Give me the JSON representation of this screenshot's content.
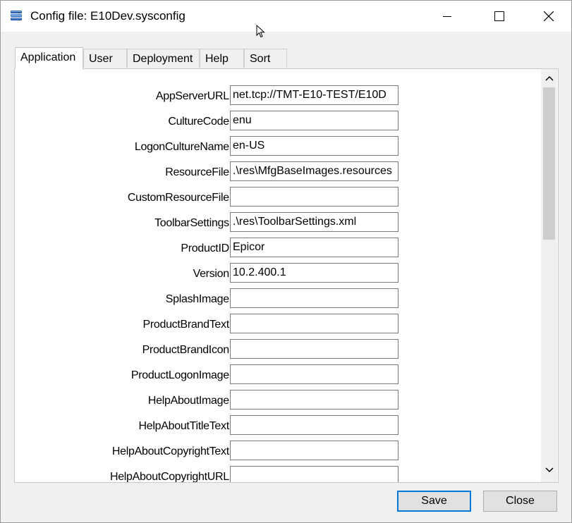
{
  "window": {
    "title": "Config file: E10Dev.sysconfig",
    "icon": "database-stack-icon"
  },
  "tabs": [
    {
      "label": "Application",
      "active": true
    },
    {
      "label": "User",
      "active": false
    },
    {
      "label": "Deployment",
      "active": false
    },
    {
      "label": "Help",
      "active": false
    },
    {
      "label": "Sort",
      "active": false
    }
  ],
  "fields": [
    {
      "label": "AppServerURL:",
      "value": "net.tcp://TMT-E10-TEST/E10D"
    },
    {
      "label": "CultureCode:",
      "value": "enu"
    },
    {
      "label": "LogonCultureName:",
      "value": "en-US"
    },
    {
      "label": "ResourceFile:",
      "value": ".\\res\\MfgBaseImages.resources"
    },
    {
      "label": "CustomResourceFile:",
      "value": ""
    },
    {
      "label": "ToolbarSettings:",
      "value": ".\\res\\ToolbarSettings.xml"
    },
    {
      "label": "ProductID:",
      "value": "Epicor"
    },
    {
      "label": "Version:",
      "value": "10.2.400.1"
    },
    {
      "label": "SplashImage:",
      "value": ""
    },
    {
      "label": "ProductBrandText:",
      "value": ""
    },
    {
      "label": "ProductBrandIcon:",
      "value": ""
    },
    {
      "label": "ProductLogonImage:",
      "value": ""
    },
    {
      "label": "HelpAboutImage:",
      "value": ""
    },
    {
      "label": "HelpAboutTitleText:",
      "value": ""
    },
    {
      "label": "HelpAboutCopyrightText:",
      "value": ""
    },
    {
      "label": "HelpAboutCopyrightURL:",
      "value": ""
    }
  ],
  "buttons": {
    "save": "Save",
    "close": "Close"
  }
}
